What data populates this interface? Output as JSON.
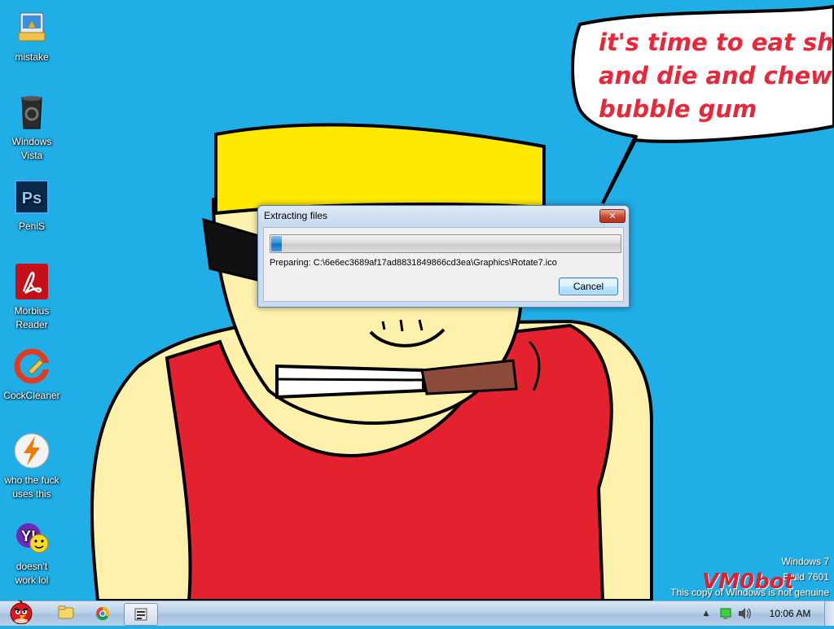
{
  "wallpaper": {
    "speech_lines": [
      "it's time to eat shit",
      "and die and chew",
      "bubble gum"
    ],
    "colors": {
      "sky": "#1faee6",
      "skin": "#fdf1ac",
      "hair": "#fde800",
      "shirt": "#e4222f",
      "cigar": "#8b4a3a",
      "speech_text": "#e8273a"
    }
  },
  "desktop_icons": [
    {
      "label_lines": [
        "mistake"
      ],
      "icon": "computer-icon"
    },
    {
      "label_lines": [
        "Windows",
        "Vista"
      ],
      "icon": "recycle-bin-icon"
    },
    {
      "label_lines": [
        "PeniS"
      ],
      "icon": "photoshop-icon"
    },
    {
      "label_lines": [
        "Morbius",
        "Reader"
      ],
      "icon": "acrobat-reader-icon"
    },
    {
      "label_lines": [
        "CockCleaner"
      ],
      "icon": "ccleaner-icon"
    },
    {
      "label_lines": [
        "who the fuck",
        "uses this"
      ],
      "icon": "winamp-icon"
    },
    {
      "label_lines": [
        "doesn't",
        "work lol"
      ],
      "icon": "yahoo-messenger-icon"
    }
  ],
  "dialog": {
    "title": "Extracting files",
    "close_label": "✕",
    "status": "Preparing: C:\\6e6ec3689af17ad8831849866cd3ea\\Graphics\\Rotate7.ico",
    "progress": 0.03,
    "cancel_label": "Cancel"
  },
  "watermark": {
    "line1": "Windows 7",
    "line2": "Build 7601",
    "line3": "This copy of Windows is not genuine",
    "brand": "VM0bot"
  },
  "taskbar": {
    "start_icon": "angry-bird-start-icon",
    "pinned": [
      "explorer-icon",
      "chrome-icon",
      "installer-icon"
    ],
    "tray": {
      "chevron": "▲",
      "icons": [
        "network-icon",
        "volume-icon"
      ]
    },
    "clock": "10:06 AM"
  }
}
